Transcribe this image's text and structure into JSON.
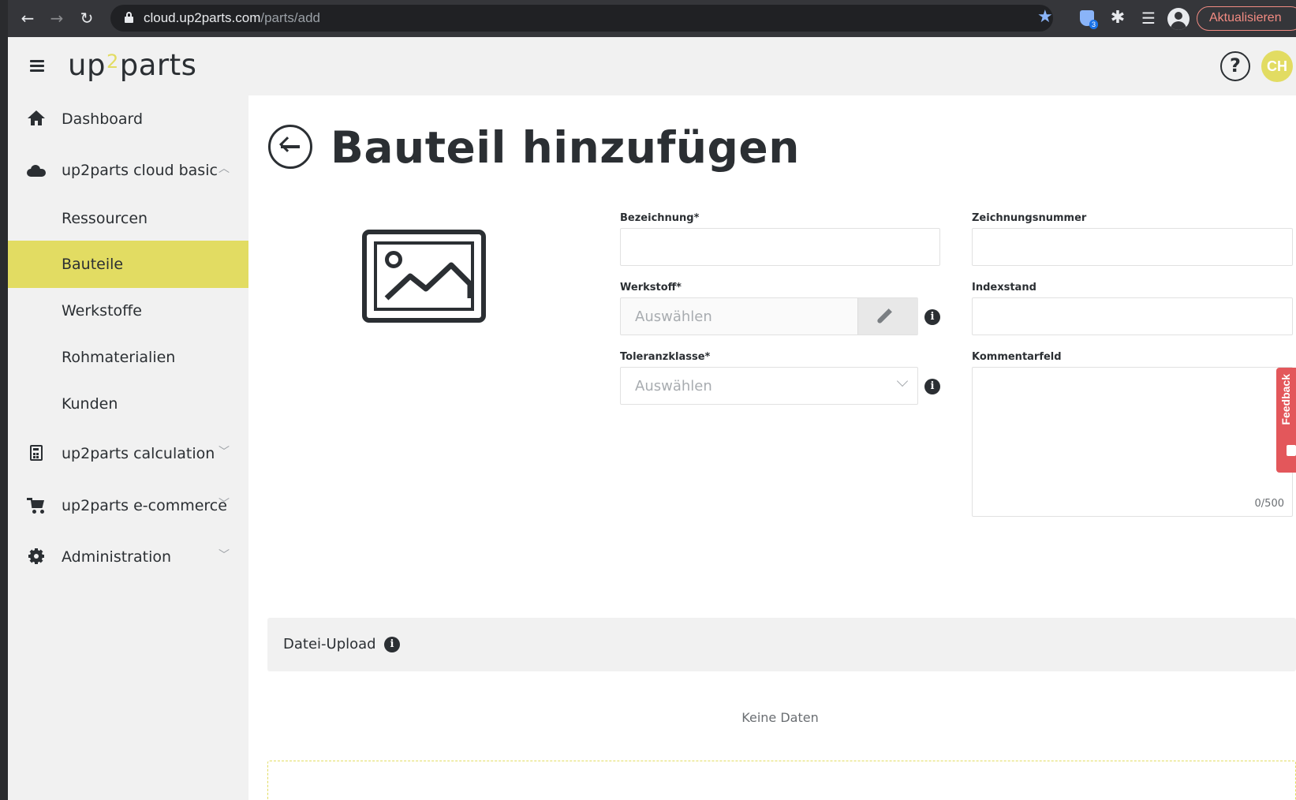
{
  "browser": {
    "url_host": "cloud.up2parts.com",
    "url_path": "/parts/add",
    "extension_badge": "3",
    "update_button": "Aktualisieren"
  },
  "header": {
    "logo_left": "up",
    "logo_mid": "2",
    "logo_right": "parts",
    "help": "?",
    "avatar_initials": "CH"
  },
  "sidebar": {
    "items": [
      {
        "label": "Dashboard",
        "icon": "home-icon"
      },
      {
        "label": "up2parts cloud basic",
        "icon": "cloud-icon",
        "chevron": "chevron-up-icon"
      },
      {
        "label": "Ressourcen"
      },
      {
        "label": "Bauteile",
        "active": true
      },
      {
        "label": "Werkstoffe"
      },
      {
        "label": "Rohmaterialien"
      },
      {
        "label": "Kunden"
      },
      {
        "label": "up2parts calculation",
        "icon": "calculator-icon",
        "chevron": "chevron-down-icon"
      },
      {
        "label": "up2parts e-commerce",
        "icon": "cart-icon",
        "chevron": "chevron-down-icon"
      },
      {
        "label": "Administration",
        "icon": "gear-icon",
        "chevron": "chevron-down-icon"
      }
    ]
  },
  "main": {
    "title": "Bauteil hinzufügen",
    "fields": {
      "bezeichnung": {
        "label": "Bezeichnung*",
        "value": ""
      },
      "zeichnungsnummer": {
        "label": "Zeichnungsnummer",
        "value": ""
      },
      "werkstoff": {
        "label": "Werkstoff*",
        "placeholder": "Auswählen"
      },
      "indexstand": {
        "label": "Indexstand",
        "value": ""
      },
      "toleranzklasse": {
        "label": "Toleranzklasse*",
        "placeholder": "Auswählen"
      },
      "kommentarfeld": {
        "label": "Kommentarfeld",
        "value": "",
        "counter": "0/500"
      }
    },
    "upload": {
      "title": "Datei-Upload",
      "empty": "Keine Daten"
    },
    "info_glyph": "i"
  },
  "feedback": {
    "label": "Feedback"
  },
  "colors": {
    "accent": "#e2dc62",
    "text": "#2b2f33",
    "feedback": "#e3575b",
    "update": "#f28b82"
  }
}
